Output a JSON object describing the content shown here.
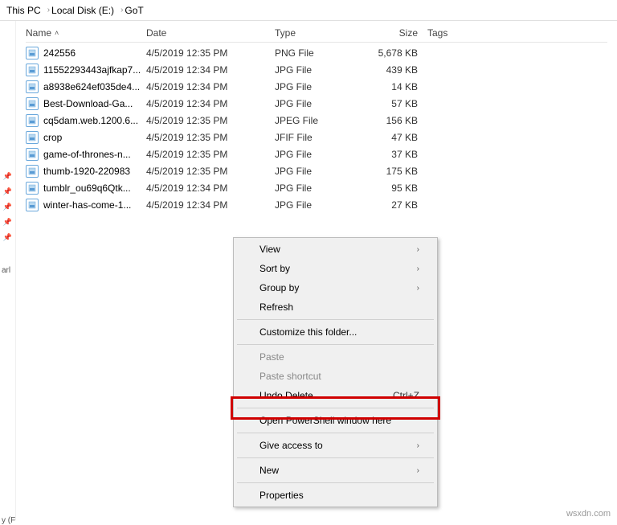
{
  "breadcrumb": {
    "root": "This PC",
    "drive": "Local Disk (E:)",
    "folder": "GoT"
  },
  "columns": {
    "name": "Name",
    "date": "Date",
    "type": "Type",
    "size": "Size",
    "tags": "Tags"
  },
  "files": [
    {
      "name": "242556",
      "date": "4/5/2019 12:35 PM",
      "type": "PNG File",
      "size": "5,678 KB"
    },
    {
      "name": "11552293443ajfkap7...",
      "date": "4/5/2019 12:34 PM",
      "type": "JPG File",
      "size": "439 KB"
    },
    {
      "name": "a8938e624ef035de4...",
      "date": "4/5/2019 12:34 PM",
      "type": "JPG File",
      "size": "14 KB"
    },
    {
      "name": "Best-Download-Ga...",
      "date": "4/5/2019 12:34 PM",
      "type": "JPG File",
      "size": "57 KB"
    },
    {
      "name": "cq5dam.web.1200.6...",
      "date": "4/5/2019 12:35 PM",
      "type": "JPEG File",
      "size": "156 KB"
    },
    {
      "name": "crop",
      "date": "4/5/2019 12:35 PM",
      "type": "JFIF File",
      "size": "47 KB"
    },
    {
      "name": "game-of-thrones-n...",
      "date": "4/5/2019 12:35 PM",
      "type": "JPG File",
      "size": "37 KB"
    },
    {
      "name": "thumb-1920-220983",
      "date": "4/5/2019 12:35 PM",
      "type": "JPG File",
      "size": "175 KB"
    },
    {
      "name": "tumblr_ou69q6Qtk...",
      "date": "4/5/2019 12:34 PM",
      "type": "JPG File",
      "size": "95 KB"
    },
    {
      "name": "winter-has-come-1...",
      "date": "4/5/2019 12:34 PM",
      "type": "JPG File",
      "size": "27 KB"
    }
  ],
  "context_menu": {
    "view": "View",
    "sort_by": "Sort by",
    "group_by": "Group by",
    "refresh": "Refresh",
    "customize": "Customize this folder...",
    "paste": "Paste",
    "paste_shortcut": "Paste shortcut",
    "undo_delete": "Undo Delete",
    "undo_shortcut": "Ctrl+Z",
    "open_powershell": "Open PowerShell window here",
    "give_access": "Give access to",
    "new": "New",
    "properties": "Properties"
  },
  "gutter": {
    "label1": "arl",
    "label2": "y (F"
  },
  "watermark": "wsxdn.com"
}
